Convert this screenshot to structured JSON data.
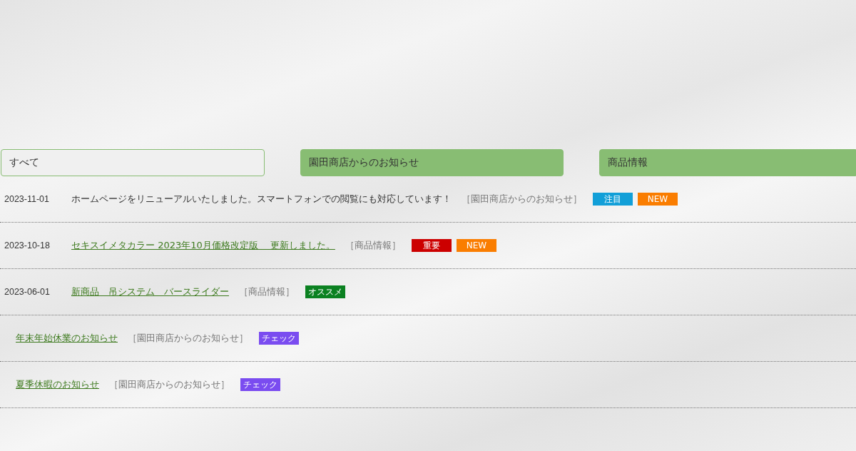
{
  "tabs": [
    {
      "label": "すべて",
      "selected": true
    },
    {
      "label": "園田商店からのお知らせ",
      "selected": false
    },
    {
      "label": "商品情報",
      "selected": false
    }
  ],
  "news": [
    {
      "date": "2023-11-01",
      "title": "ホームページをリニューアルいたしました。スマートフォンでの閲覧にも対応しています！",
      "link": false,
      "category": "［園田商店からのお知らせ］",
      "tags": [
        {
          "label": "注目",
          "color": "#129fd8"
        },
        {
          "label": "NEW",
          "color": "#fa7d00"
        }
      ]
    },
    {
      "date": "2023-10-18",
      "title": "セキスイメタカラー 2023年10月価格改定版　 更新しました。",
      "link": true,
      "category": "［商品情報］",
      "tags": [
        {
          "label": "重要",
          "color": "#cc0000"
        },
        {
          "label": "NEW",
          "color": "#fa7d00"
        }
      ]
    },
    {
      "date": "2023-06-01",
      "title": "新商品　吊システム　バースライダー",
      "link": true,
      "category": "［商品情報］",
      "tags": [
        {
          "label": "オススメ",
          "color": "#0b8121"
        }
      ]
    },
    {
      "title": "年末年始休業のお知らせ",
      "link": true,
      "category": "［園田商店からのお知らせ］",
      "tags": [
        {
          "label": "チェック",
          "color": "#7a4cf0"
        }
      ]
    },
    {
      "title": "夏季休暇のお知らせ",
      "link": true,
      "category": "［園田商店からのお知らせ］",
      "tags": [
        {
          "label": "チェック",
          "color": "#7a4cf0"
        }
      ]
    }
  ]
}
